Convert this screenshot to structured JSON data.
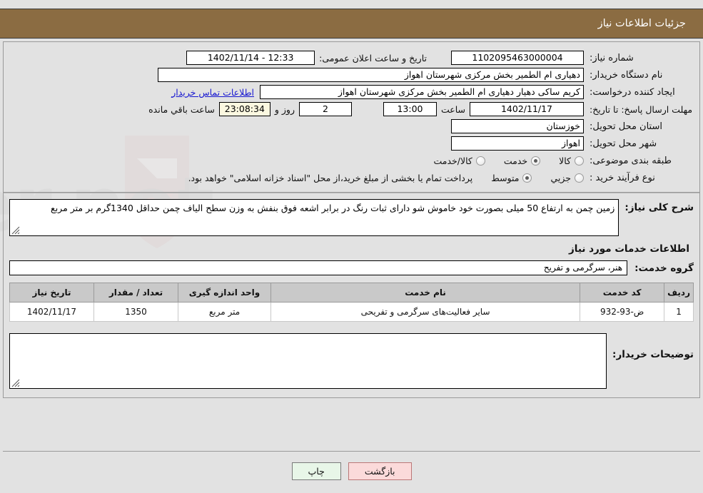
{
  "header": {
    "title": "جزئیات اطلاعات نیاز"
  },
  "form": {
    "need_number_label": "شماره نیاز:",
    "need_number_value": "1102095463000004",
    "public_announce_label": "تاریخ و ساعت اعلان عمومی:",
    "public_announce_value": "12:33 - 1402/11/14",
    "buyer_org_label": "نام دستگاه خریدار:",
    "buyer_org_value": "دهیاری ام الطمیر بخش مرکزی شهرستان اهواز",
    "creator_label": "ایجاد کننده درخواست:",
    "creator_value": "کریم ساکی دهیار دهیاری ام الطمیر بخش مرکزی شهرستان اهواز",
    "contact_link": "اطلاعات تماس خریدار",
    "deadline_label": "مهلت ارسال پاسخ: تا تاریخ:",
    "deadline_date": "1402/11/17",
    "deadline_hour_label": "ساعت",
    "deadline_hour_value": "13:00",
    "remaining_days_value": "2",
    "remaining_days_label": "روز و",
    "remaining_time_value": "23:08:34",
    "remaining_time_label": "ساعت باقي مانده",
    "province_label": "استان محل تحویل:",
    "province_value": "خوزستان",
    "city_label": "شهر محل تحویل:",
    "city_value": "اهواز",
    "category_label": "طبقه بندی موضوعی:",
    "category_options": [
      {
        "label": "کالا",
        "selected": false
      },
      {
        "label": "خدمت",
        "selected": true
      },
      {
        "label": "کالا/خدمت",
        "selected": false
      }
    ],
    "process_label": "نوع فرآیند خرید :",
    "process_options": [
      {
        "label": "جزیي",
        "selected": false
      },
      {
        "label": "متوسط",
        "selected": true
      }
    ],
    "process_note": "پرداخت تمام یا بخشی از مبلغ خرید،از محل \"اسناد خزانه اسلامی\" خواهد بود."
  },
  "description": {
    "label": "شرح کلی نیاز:",
    "value": "زمین چمن به ارتفاع 50 میلی بصورت خود خاموش شو دارای ثبات رنگ در برابر اشعه فوق بنفش به وزن سطح الیاف چمن حداقل 1340گرم بر متر مربع"
  },
  "services": {
    "subtitle": "اطلاعات خدمات مورد نیاز",
    "group_label": "گروه خدمت:",
    "group_value": "هنر، سرگرمی و تفریح",
    "columns": [
      "ردیف",
      "کد خدمت",
      "نام خدمت",
      "واحد اندازه گیری",
      "تعداد / مقدار",
      "تاریخ نیاز"
    ],
    "rows": [
      {
        "row": "1",
        "code": "ض-93-932",
        "name": "سایر فعالیت‌های سرگرمی و تفریحی",
        "unit": "متر مربع",
        "qty": "1350",
        "date": "1402/11/17"
      }
    ]
  },
  "comments": {
    "label": "توضیحات خریدار:",
    "value": ""
  },
  "footer": {
    "print_label": "چاپ",
    "back_label": "بازگشت"
  },
  "watermark": {
    "text": "AriaTender.net"
  },
  "colors": {
    "header_bg": "#8b6c42",
    "page_bg": "#e2e2e2",
    "link": "#1616d0",
    "print_btn": "#e8f6e8",
    "back_btn": "#fbdada",
    "table_header": "#c9c9c9",
    "countdown_bg": "#fbf8e0"
  }
}
